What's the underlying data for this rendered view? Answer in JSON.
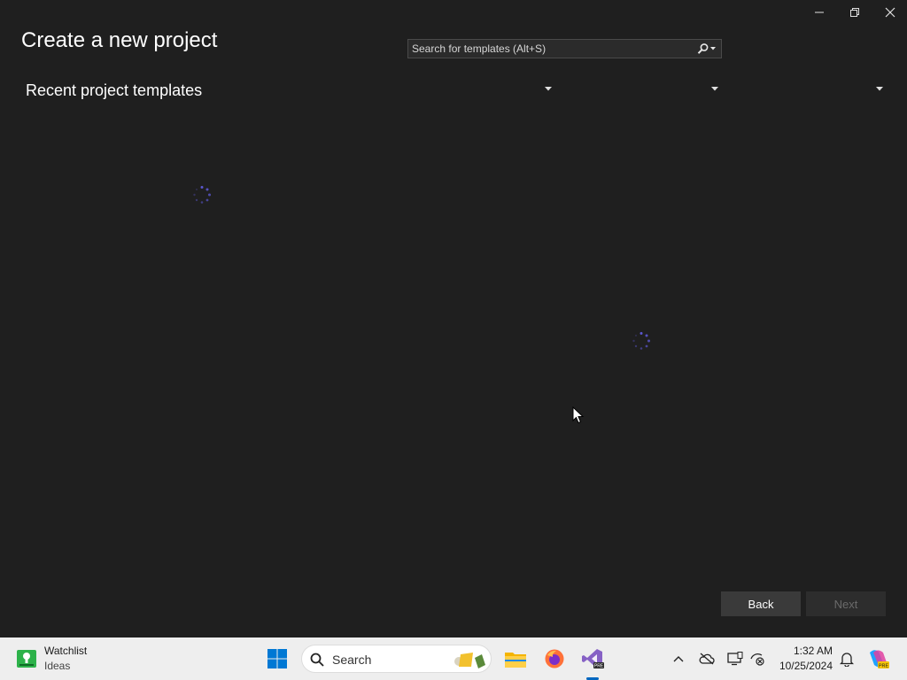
{
  "window": {
    "title": "Create a new project",
    "controls": [
      "minimize-icon",
      "restore-icon",
      "close-icon"
    ]
  },
  "search": {
    "placeholder": "Search for templates (Alt+S)",
    "value": "",
    "icon": "search-icon"
  },
  "recent": {
    "heading": "Recent project templates"
  },
  "filters": {
    "dropdowns": [
      {
        "icon": "chevron-down-icon",
        "value": ""
      },
      {
        "icon": "chevron-down-icon",
        "value": ""
      },
      {
        "icon": "chevron-down-icon",
        "value": ""
      }
    ]
  },
  "loading": {
    "spinner_color": "#5b57d1"
  },
  "footer": {
    "back_label": "Back",
    "next_label": "Next"
  },
  "taskbar": {
    "weather": {
      "title": "Watchlist",
      "subtitle": "Ideas",
      "icon": "stock-chart-icon"
    },
    "search_label": "Search",
    "pinned": [
      "windows-start-icon",
      "search-icon",
      "file-explorer-icon",
      "firefox-icon",
      "visual-studio-preview-icon"
    ],
    "tray_icons": [
      "chevron-up-icon",
      "onedrive-offline-icon",
      "display-icon",
      "network-disconnected-icon"
    ],
    "clock": {
      "time": "1:32 AM",
      "date": "10/25/2024"
    },
    "notification_icon": "bell-icon",
    "copilot_icon": "copilot-icon"
  },
  "colors": {
    "background": "#1f1f1f",
    "accent": "#5b57d1",
    "taskbar": "#eeeeee"
  }
}
